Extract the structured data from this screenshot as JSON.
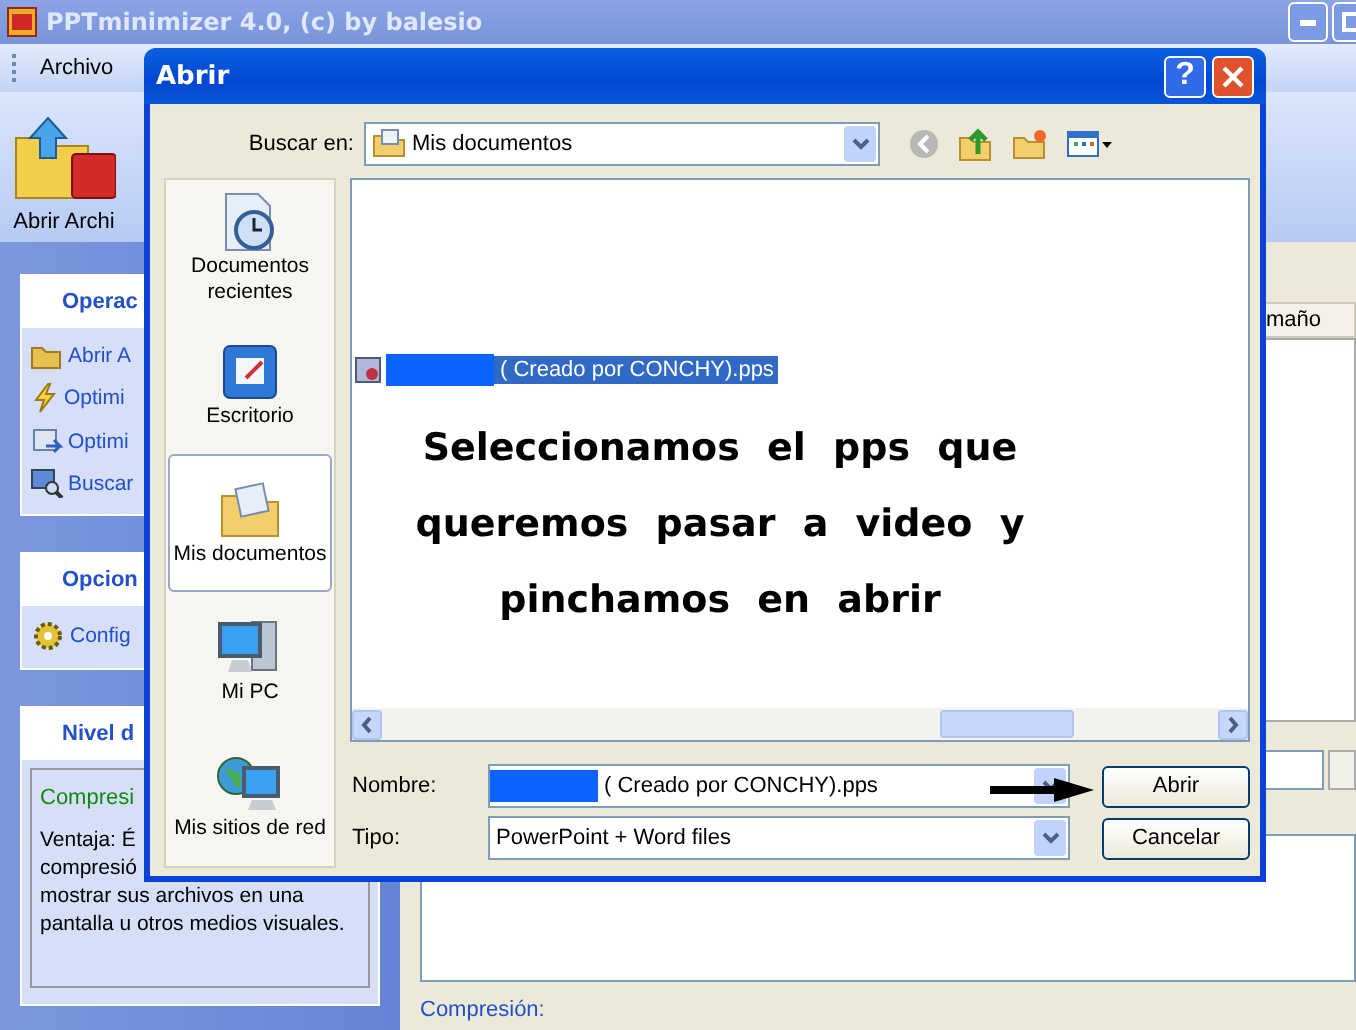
{
  "app": {
    "title": "PPTminimizer 4.0, (c) by balesio",
    "menu": [
      "Archivo"
    ],
    "toolbar": [
      {
        "label": "Abrir Archi"
      }
    ],
    "sidebar": [
      {
        "title": "Operac",
        "items": [
          {
            "label": "Abrir A",
            "kind": "folder"
          },
          {
            "label": "Optimi",
            "kind": "lightning"
          },
          {
            "label": "Optimi",
            "kind": "optimize"
          },
          {
            "label": "Buscar",
            "kind": "search"
          }
        ]
      },
      {
        "title": "Opcion",
        "items": [
          {
            "label": "Config",
            "kind": "gear"
          }
        ]
      },
      {
        "title": "Nivel d",
        "box_title": "Compresi",
        "box_lines": [
          "Ventaja: É",
          "compresió",
          "mostrar sus archivos en una",
          "pantalla u otros medios visuales."
        ]
      }
    ],
    "column_header": "maño",
    "compression_label": "Compresión:"
  },
  "dialog": {
    "title": "Abrir",
    "help": "?",
    "look_in": {
      "label": "Buscar en:",
      "value": "Mis documentos"
    },
    "places": [
      {
        "label": "Documentos recientes",
        "kind": "recent",
        "selected": false
      },
      {
        "label": "Escritorio",
        "kind": "desktop",
        "selected": false
      },
      {
        "label": "Mis documentos",
        "kind": "documents",
        "selected": true
      },
      {
        "label": "Mi PC",
        "kind": "computer",
        "selected": false
      },
      {
        "label": "Mis sitios de red",
        "kind": "network",
        "selected": false
      }
    ],
    "files": [
      {
        "name": "( Creado por CONCHY).pps",
        "selected": true
      }
    ],
    "note": "Seleccionamos el pps que queremos pasar a video y pinchamos en abrir",
    "file_name": {
      "label": "Nombre:",
      "value": "( Creado por CONCHY).pps"
    },
    "file_type": {
      "label": "Tipo:",
      "value": "PowerPoint + Word files"
    },
    "buttons": [
      "Abrir",
      "Cancelar"
    ]
  }
}
